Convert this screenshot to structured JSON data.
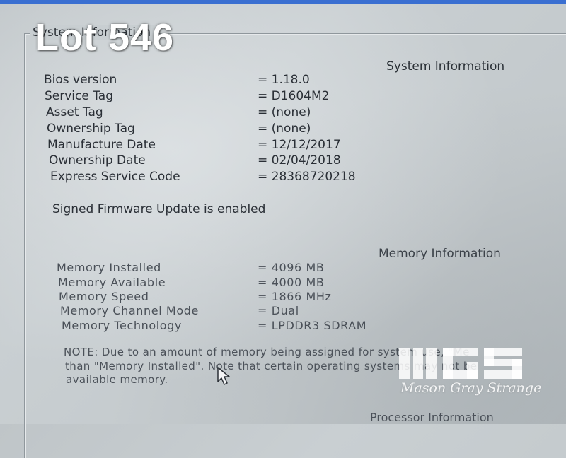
{
  "window": {
    "frame_title": "System Information",
    "accent": "#3a6fd1"
  },
  "overlay": {
    "lot_label": "Lot 546",
    "watermark_text": "Mason Gray Strange"
  },
  "system_info": {
    "heading": "System Information",
    "rows": [
      {
        "label": "Bios version",
        "value": "= 1.18.0"
      },
      {
        "label": "Service Tag",
        "value": "= D1604M2"
      },
      {
        "label": "Asset Tag",
        "value": "= (none)"
      },
      {
        "label": "Ownership Tag",
        "value": "= (none)"
      },
      {
        "label": "Manufacture Date",
        "value": "= 12/12/2017"
      },
      {
        "label": "Ownership Date",
        "value": "= 02/04/2018"
      },
      {
        "label": "Express Service Code",
        "value": "= 28368720218"
      }
    ],
    "firmware_status": "Signed Firmware Update is enabled"
  },
  "memory_info": {
    "heading": "Memory Information",
    "rows": [
      {
        "label": "Memory Installed",
        "value": "= 4096 MB"
      },
      {
        "label": "Memory Available",
        "value": "= 4000 MB"
      },
      {
        "label": "Memory Speed",
        "value": "= 1866 MHz"
      },
      {
        "label": "Memory Channel Mode",
        "value": "= Dual"
      },
      {
        "label": "Memory Technology",
        "value": "= LPDDR3 SDRAM"
      }
    ],
    "note_lines": [
      "NOTE: Due to an amount of memory being assigned for system use, \"Me",
      "than \"Memory Installed\". Note that certain operating systems may not be",
      "available memory."
    ]
  },
  "processor_info": {
    "heading": "Processor Information"
  }
}
